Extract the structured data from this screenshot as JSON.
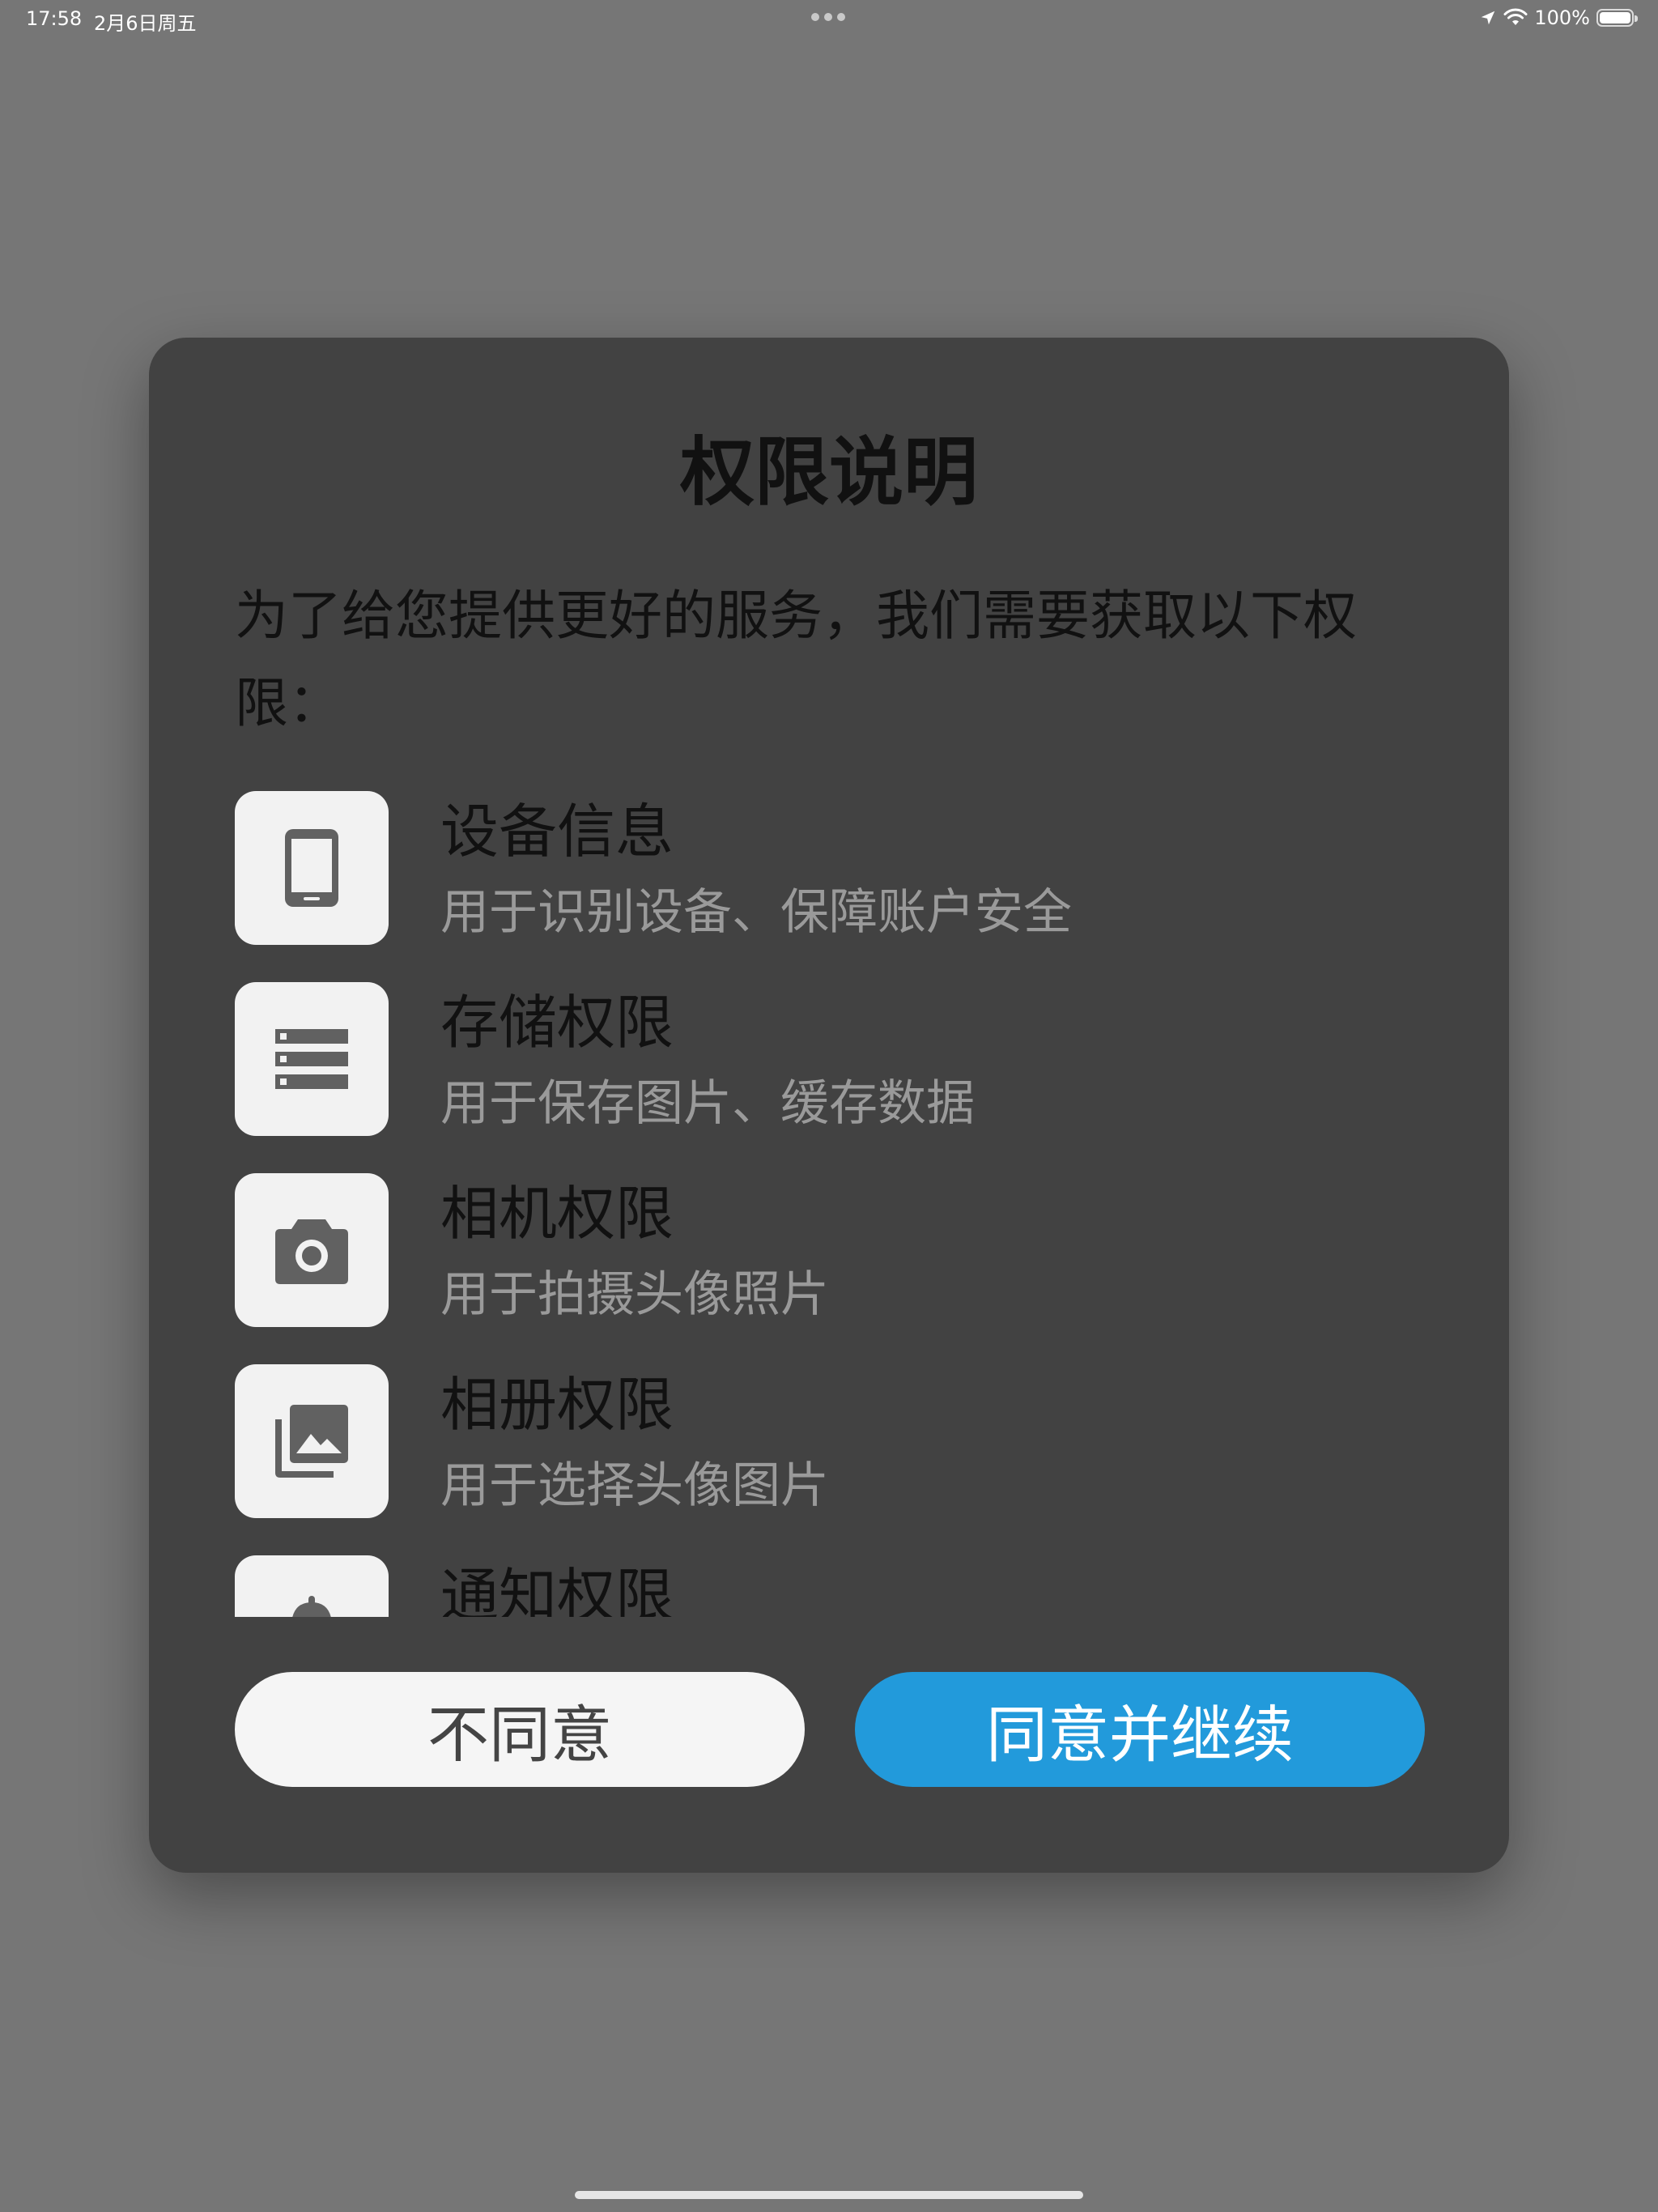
{
  "status_bar": {
    "time": "17:58",
    "date": "2月6日周五",
    "battery": "100%"
  },
  "dialog": {
    "title": "权限说明",
    "description": "为了给您提供更好的服务，我们需要获取以下权限：",
    "permissions": [
      {
        "title": "设备信息",
        "subtitle": "用于识别设备、保障账户安全",
        "icon": "phone-icon"
      },
      {
        "title": "存储权限",
        "subtitle": "用于保存图片、缓存数据",
        "icon": "storage-icon"
      },
      {
        "title": "相机权限",
        "subtitle": "用于拍摄头像照片",
        "icon": "camera-icon"
      },
      {
        "title": "相册权限",
        "subtitle": "用于选择头像图片",
        "icon": "photo-library-icon"
      },
      {
        "title": "通知权限",
        "icon": "bell-icon"
      }
    ],
    "decline_label": "不同意",
    "accept_label": "同意并继续"
  },
  "colors": {
    "backdrop": "#767676",
    "dialog_bg": "#424242",
    "accent": "#229adb",
    "icon_tile": "#f2f2f2",
    "icon_glyph": "#616161"
  }
}
